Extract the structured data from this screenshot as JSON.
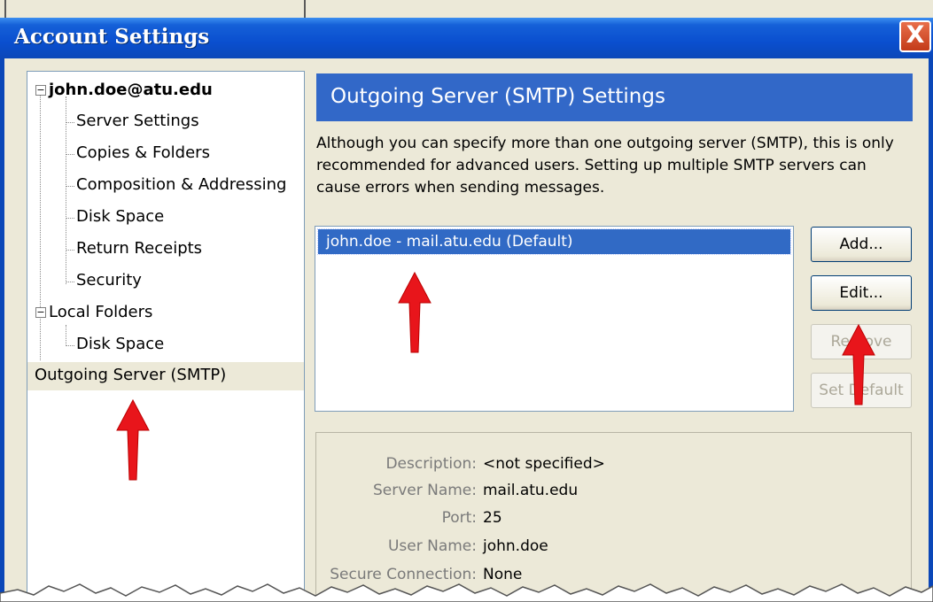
{
  "window": {
    "title": "Account Settings",
    "close_glyph": "X"
  },
  "tree": {
    "account": {
      "label": "john.doe@atu.edu",
      "expander": "−"
    },
    "account_items": [
      "Server Settings",
      "Copies & Folders",
      "Composition & Addressing",
      "Disk Space",
      "Return Receipts",
      "Security"
    ],
    "local": {
      "label": "Local Folders",
      "expander": "−"
    },
    "local_items": [
      "Disk Space"
    ],
    "outgoing": {
      "label": "Outgoing Server (SMTP)"
    }
  },
  "panel": {
    "title": "Outgoing Server (SMTP) Settings",
    "description": "Although you can specify more than one outgoing server (SMTP), this is only recommended for advanced users. Setting up multiple SMTP servers can cause errors when sending messages.",
    "servers": [
      "john.doe - mail.atu.edu (Default)"
    ],
    "buttons": {
      "add": "Add...",
      "edit": "Edit...",
      "remove": "Remove",
      "set_default": "Set Default"
    },
    "details": {
      "description_label": "Description:",
      "description_value": "<not specified>",
      "server_label": "Server Name:",
      "server_value": "mail.atu.edu",
      "port_label": "Port:",
      "port_value": "25",
      "user_label": "User Name:",
      "user_value": "john.doe",
      "secure_label": "Secure Connection:",
      "secure_value": "None"
    }
  },
  "colors": {
    "title_bar": "#0a4fcf",
    "header": "#3268c8",
    "selection": "#316ac5",
    "arrow": "#e8151b"
  },
  "icons": [
    "close-icon",
    "collapse-icon",
    "red-arrow-icon"
  ]
}
